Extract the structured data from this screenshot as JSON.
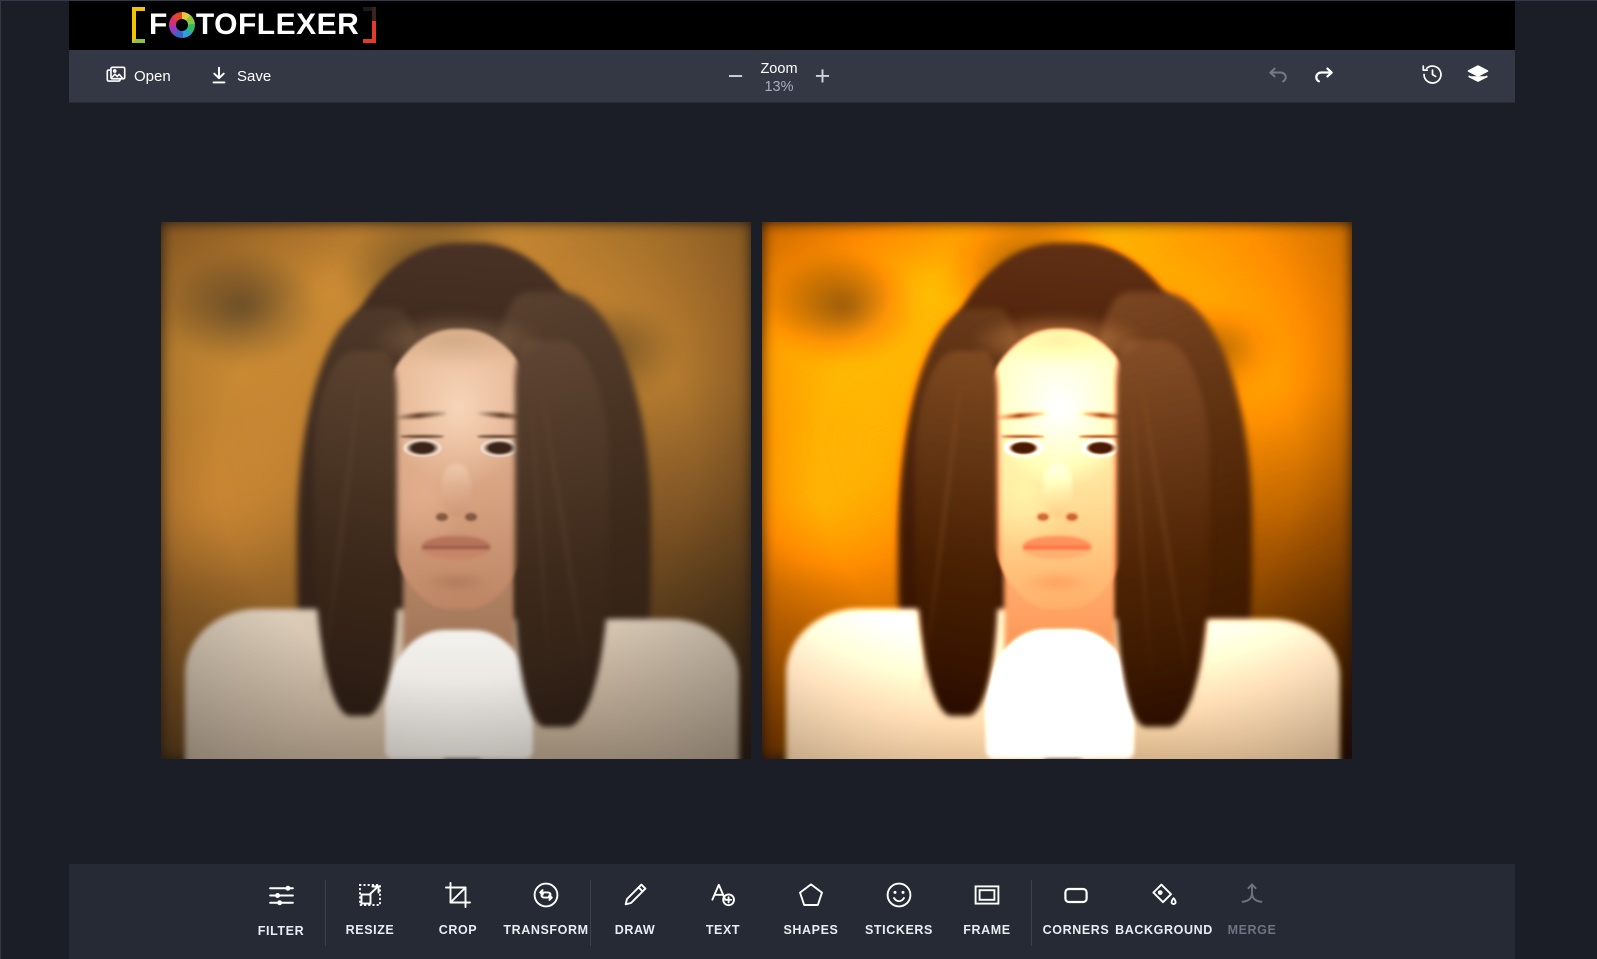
{
  "app": {
    "brand": {
      "name": "FOTOFLEXER",
      "part1": "F",
      "aperture_icon": "aperture-icon",
      "part2": "TOFLEXER"
    },
    "background_color": "#1b1e27",
    "toolbar_color": "#343845",
    "bottombar_color": "#262a35"
  },
  "toolbar": {
    "open_label": "Open",
    "open_icon": "photos-stack-icon",
    "save_label": "Save",
    "save_icon": "download-icon",
    "zoom": {
      "minus_label": "−",
      "label": "Zoom",
      "value": "13%",
      "plus_label": "+"
    },
    "right_tools": [
      {
        "name": "undo",
        "icon": "undo-arrow-icon",
        "enabled": false
      },
      {
        "name": "redo",
        "icon": "redo-arrow-icon",
        "enabled": true
      },
      {
        "name": "history",
        "icon": "history-clock-icon",
        "enabled": true
      },
      {
        "name": "layers",
        "icon": "layers-icon",
        "enabled": true
      }
    ]
  },
  "canvas": {
    "images": [
      {
        "name": "original",
        "alt": "Portrait of a woman with long brown hair, warm golden autumn bokeh background"
      },
      {
        "name": "edited",
        "alt": "Same portrait with brightness, contrast and saturation filter applied"
      }
    ]
  },
  "bottom_toolbar": {
    "groups": [
      {
        "name": "adjust",
        "tools": [
          {
            "label": "FILTER",
            "icon": "sliders-icon",
            "enabled": true
          }
        ]
      },
      {
        "name": "geometry",
        "tools": [
          {
            "label": "RESIZE",
            "icon": "resize-icon",
            "enabled": true
          },
          {
            "label": "CROP",
            "icon": "crop-icon",
            "enabled": true
          },
          {
            "label": "TRANSFORM",
            "icon": "transform-icon",
            "enabled": true
          }
        ]
      },
      {
        "name": "create",
        "tools": [
          {
            "label": "DRAW",
            "icon": "pencil-icon",
            "enabled": true
          },
          {
            "label": "TEXT",
            "icon": "add-text-icon",
            "enabled": true
          },
          {
            "label": "SHAPES",
            "icon": "pentagon-icon",
            "enabled": true
          },
          {
            "label": "STICKERS",
            "icon": "smiley-icon",
            "enabled": true
          },
          {
            "label": "FRAME",
            "icon": "frame-icon",
            "enabled": true
          }
        ]
      },
      {
        "name": "finish",
        "tools": [
          {
            "label": "CORNERS",
            "icon": "rounded-rect-icon",
            "enabled": true
          },
          {
            "label": "BACKGROUND",
            "icon": "paint-bucket-icon",
            "enabled": true
          },
          {
            "label": "MERGE",
            "icon": "merge-arrow-icon",
            "enabled": false
          }
        ]
      }
    ]
  }
}
